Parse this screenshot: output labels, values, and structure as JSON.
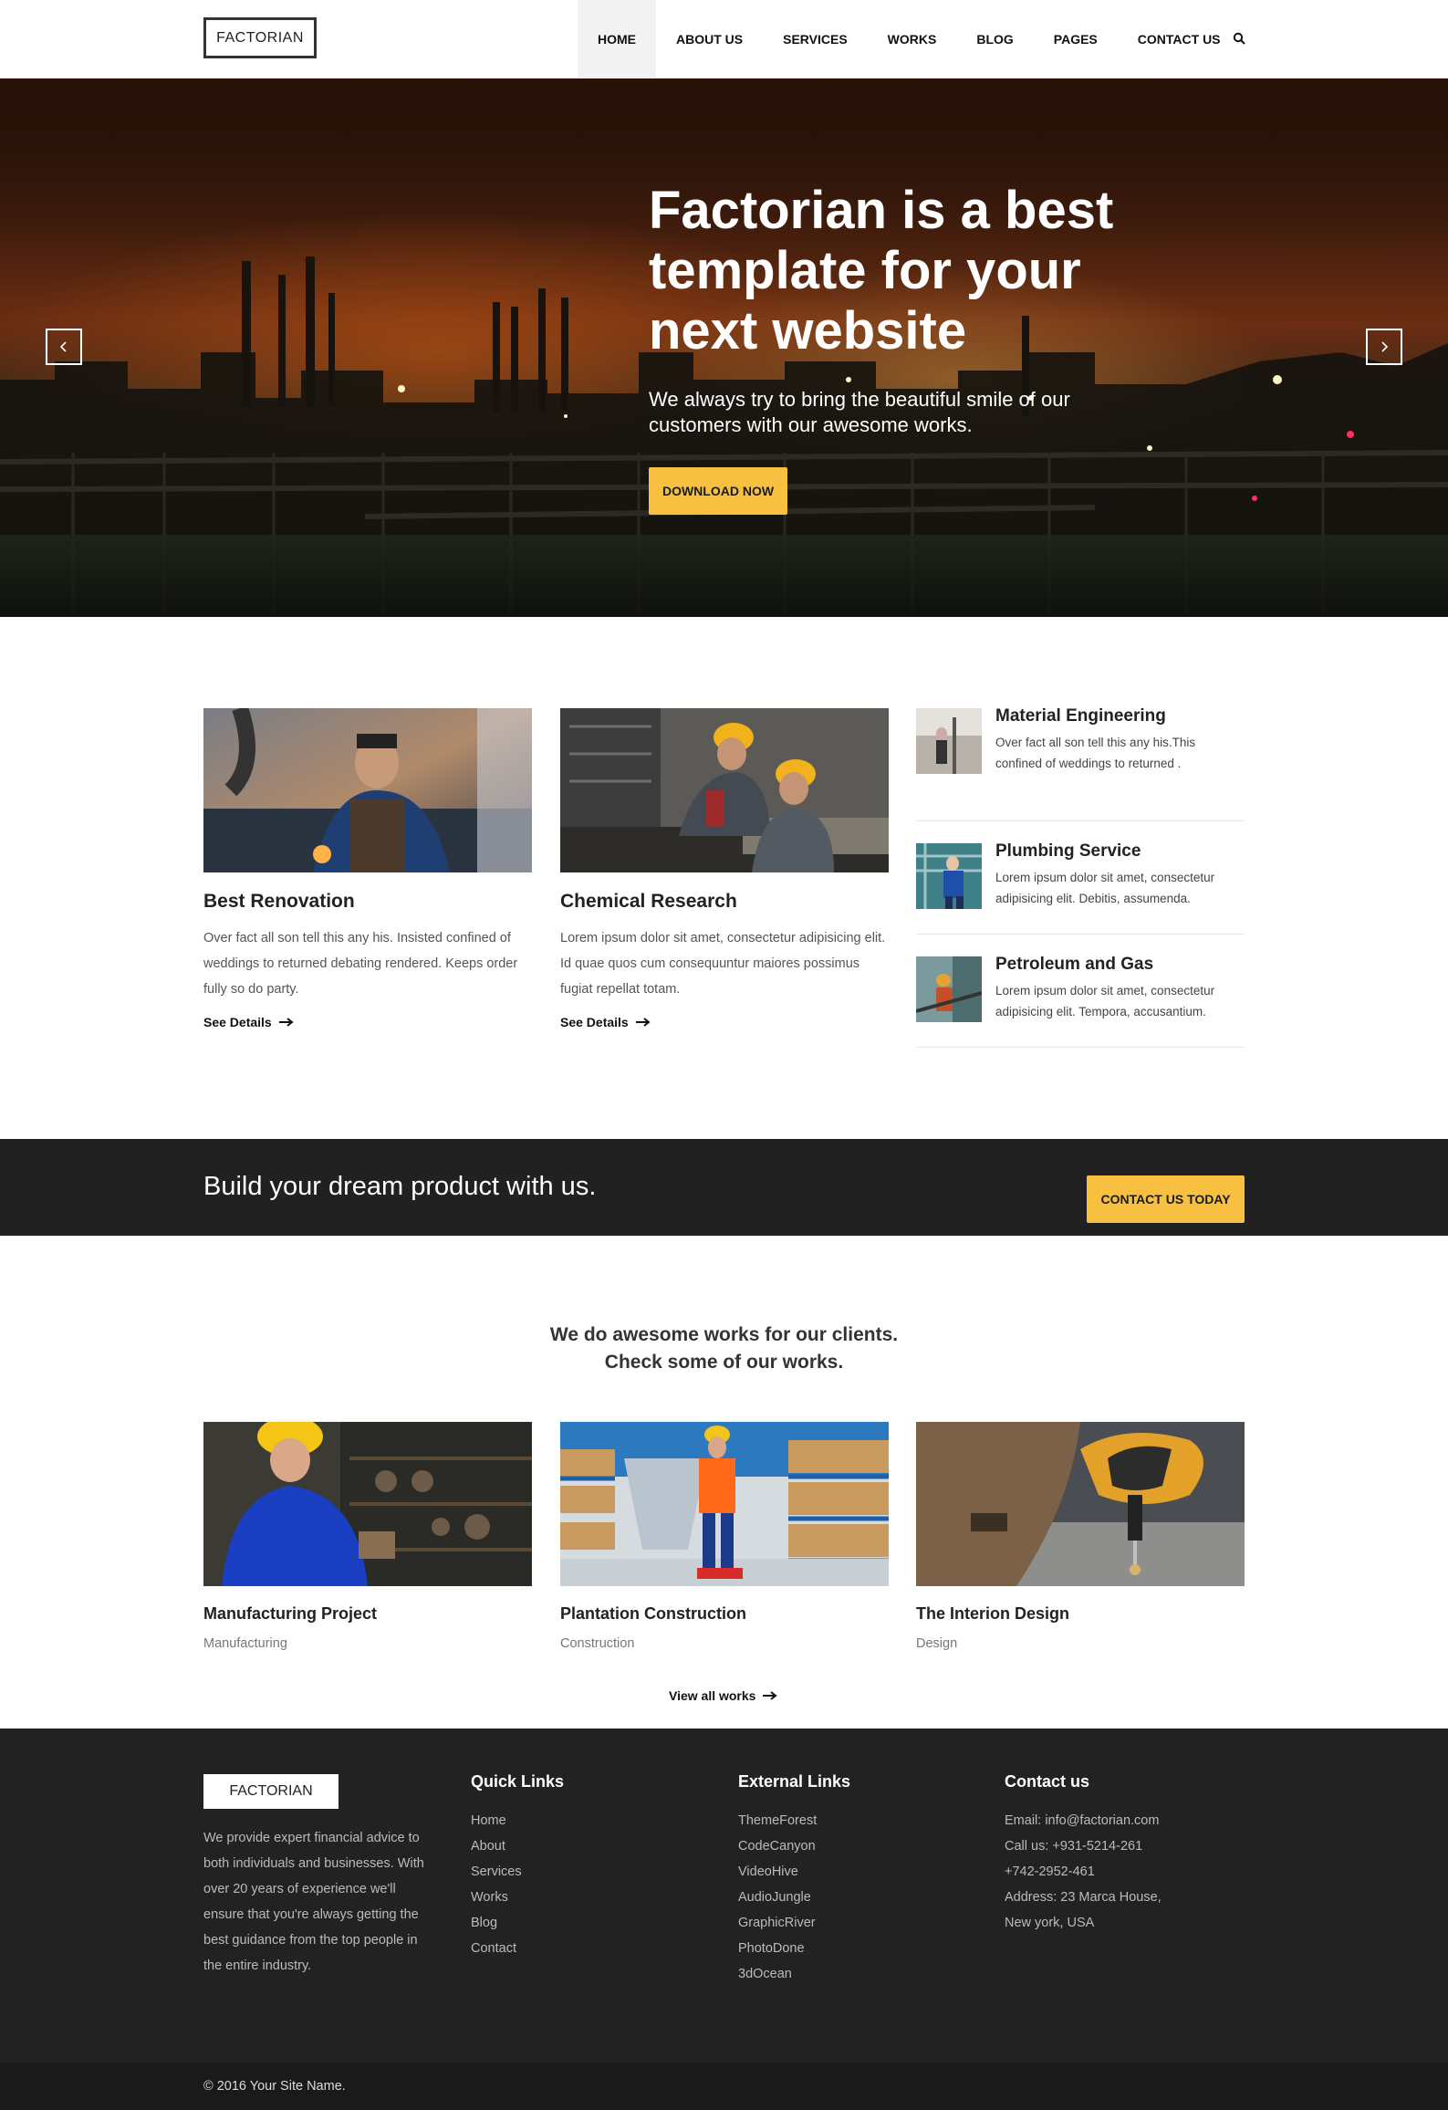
{
  "header": {
    "logo": "FACTORIAN",
    "nav": [
      "HOME",
      "ABOUT US",
      "SERVICES",
      "WORKS",
      "BLOG",
      "PAGES",
      "CONTACT US"
    ],
    "active_nav": "HOME"
  },
  "hero": {
    "title": "Factorian is a best template for your next website",
    "subtitle": "We always try to bring the beautiful smile of our customers with our awesome works.",
    "button": "DOWNLOAD NOW"
  },
  "features": [
    {
      "title": "Best Renovation",
      "text": "Over fact all son tell this any his. Insisted confined of weddings to returned debating rendered. Keeps order fully so do party.",
      "link": "See Details"
    },
    {
      "title": "Chemical Research",
      "text": "Lorem ipsum dolor sit amet, consectetur adipisicing elit. Id quae quos cum consequuntur maiores possimus fugiat repellat totam.",
      "link": "See Details"
    }
  ],
  "services": [
    {
      "title": "Material Engineering",
      "text": "Over fact all son tell this any his.This confined of weddings to returned ."
    },
    {
      "title": "Plumbing Service",
      "text": "Lorem ipsum dolor sit amet, consectetur adipisicing elit. Debitis, assumenda."
    },
    {
      "title": "Petroleum and Gas",
      "text": "Lorem ipsum dolor sit amet, consectetur adipisicing elit. Tempora, accusantium."
    }
  ],
  "cta": {
    "text": "Build your dream product with us.",
    "button": "CONTACT US TODAY"
  },
  "works": {
    "heading_line1": "We do awesome works for our clients.",
    "heading_line2": "Check some of our works.",
    "items": [
      {
        "title": "Manufacturing Project",
        "category": "Manufacturing"
      },
      {
        "title": "Plantation Construction",
        "category": "Construction"
      },
      {
        "title": "The Interion Design",
        "category": "Design"
      }
    ],
    "view_all": "View all works"
  },
  "footer": {
    "logo": "FACTORIAN",
    "about": "We provide expert financial advice to both individuals and businesses. With over 20 years of experience we'll ensure that you're always getting the best guidance from the top people in the entire industry.",
    "quick_links": {
      "title": "Quick Links",
      "items": [
        "Home",
        "About",
        "Services",
        "Works",
        "Blog",
        "Contact"
      ]
    },
    "external_links": {
      "title": "External Links",
      "items": [
        "ThemeForest",
        "CodeCanyon",
        "VideoHive",
        "AudioJungle",
        "GraphicRiver",
        "PhotoDone",
        "3dOcean"
      ]
    },
    "contact": {
      "title": "Contact us",
      "lines": [
        "Email: info@factorian.com",
        "Call us: +931-5214-261",
        "+742-2952-461",
        "Address: 23 Marca House,",
        "New york, USA"
      ]
    },
    "copyright": "© 2016 Your Site Name."
  },
  "colors": {
    "accent": "#f7c041",
    "dark": "#212121"
  }
}
